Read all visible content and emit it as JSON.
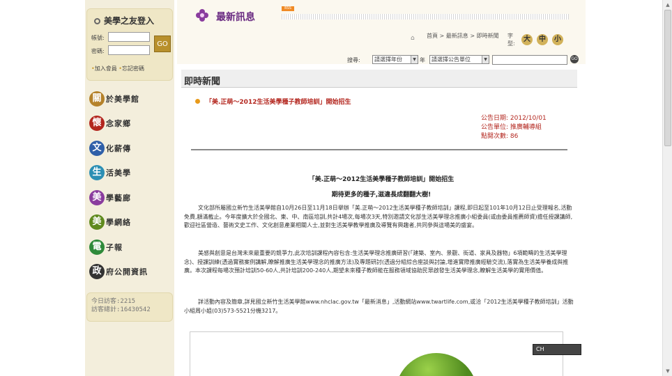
{
  "sidebar": {
    "login_title": "美學之友登入",
    "account_label": "帳號:",
    "password_label": "密碼:",
    "go_label": "GO",
    "join_label": "加入會員",
    "forgot_label": "忘記密碼",
    "nav": [
      {
        "char": "關",
        "rest": "於美學館",
        "color": "#b5822a"
      },
      {
        "char": "懷",
        "rest": "念家鄉",
        "color": "#b3261e"
      },
      {
        "char": "文",
        "rest": "化薪傳",
        "color": "#2f5fa8"
      },
      {
        "char": "生",
        "rest": "活美學",
        "color": "#2c8fb4"
      },
      {
        "char": "美",
        "rest": "學藝廊",
        "color": "#8a3c9e"
      },
      {
        "char": "美",
        "rest": "學網絡",
        "color": "#5f8a1e"
      },
      {
        "char": "電",
        "rest": "子報",
        "color": "#2e8a3a"
      },
      {
        "char": "政",
        "rest": "府公開資訊",
        "color": "#333333"
      }
    ],
    "counter_today": "今日訪客:2215",
    "counter_total": "訪客總計:16430542"
  },
  "header": {
    "section_title": "最新訊息",
    "rss_label": "RSS",
    "breadcrumb": "首頁 > 最新訊息 > 即時新聞",
    "font_label": "字型:",
    "font_sizes": [
      "大",
      "中",
      "小"
    ]
  },
  "search": {
    "label": "搜尋:",
    "year_select": "請選擇年份",
    "year_suffix": "年",
    "unit_select": "請選擇公告單位",
    "go_label": "GO"
  },
  "news": {
    "heading": "即時新聞",
    "title": "「美.正萌～2012生活美學種子教師培訓」開始招生",
    "meta_date": "公告日期: 2012/10/01",
    "meta_unit": "公告單位: 推廣輔導組",
    "meta_clicks": "點閱次數: 86",
    "body_title": "「美.正萌～2012生活美學種子教師培訓」開始招生",
    "body_sub": "期待更多的種子,滋違長成翻翻大樹!",
    "p1": "文化部所屬國立新竹生活美學館自10月26日至11月18日舉辦「美.正萌～2012生活美學種子教師培訓」課程,即日起至101年10月12日止受理報名,活動免費,額滿截止。今年度擴大於全國北、東、中、南區培訓,共計4場次,每場次3天,特別邀請文化部生活美學理念推廣小組委員(或由委員推薦師資)擔任授課講師,歡迎社區營造、藝術文史工作、文化創意產業相關人士,並對生活美學教學推廣及導覽有興趣者,共同參與這場美的盛宴。",
    "p2": "美感與創意是台灣未來最重要的競爭力,此次培訓課程內容包含:生活美學理念推廣研習(「建築、室內、景觀、街道、家具及器物」6項範疇的生活美學理念)、授課訓練(透過實務案例講解,瞭解推廣生活美學理念的推廣方法)及專題研討(透過分組綜合座談與討論,增進實際推廣經驗交流),落實為生活美學養成與推廣。本次課程每場次預計培訓50-60人,共計培訓200-240人,期望未來種子教師能在服務領域協助民眾啟發生活美學理念,瞭解生活美學的實用價值。",
    "p3": "詳活動內容及簡章,詳見國立新竹生活美學館www.nhclac.gov.tw「最新消息」,活動網站www.twartlife.com,或洽「2012生活美學種子教師培訓」活動小組周小姐(03)573-5521分機3217。"
  },
  "floating_toolbar": "CH"
}
